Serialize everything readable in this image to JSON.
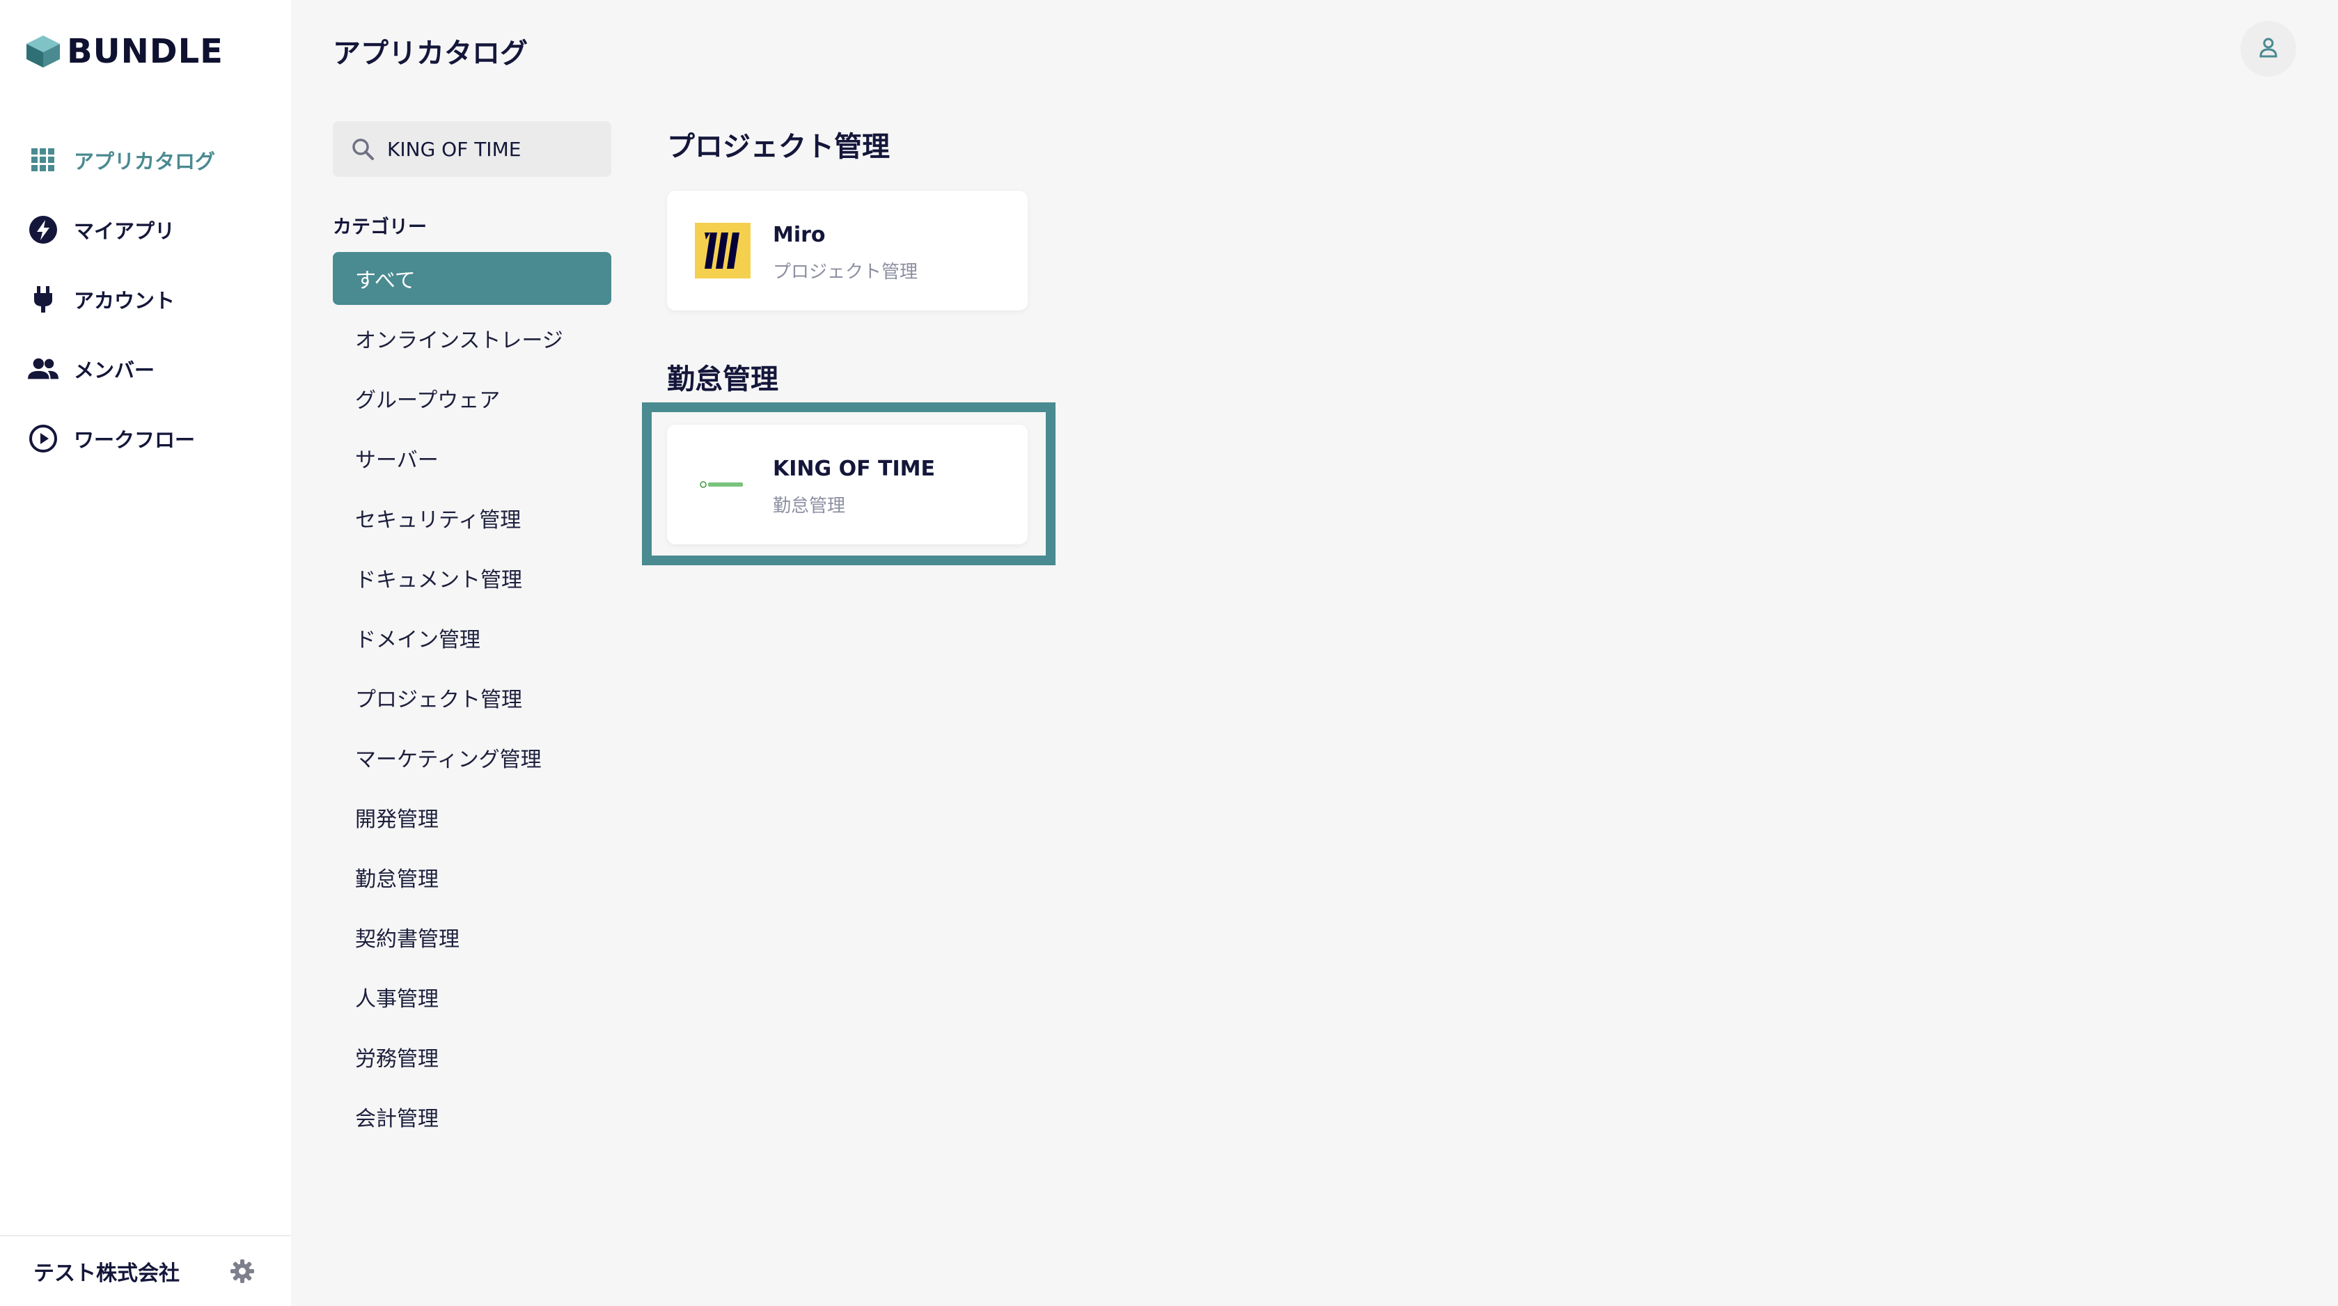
{
  "app": {
    "brand": "BUNDLE",
    "page_title": "アプリカタログ"
  },
  "colors": {
    "accent": "#4a8a91",
    "text": "#14163a",
    "miro_yellow": "#f5d04f"
  },
  "nav": {
    "items": [
      {
        "label": "アプリカタログ",
        "icon": "grid-icon",
        "active": true
      },
      {
        "label": "マイアプリ",
        "icon": "lightning-icon"
      },
      {
        "label": "アカウント",
        "icon": "plug-icon"
      },
      {
        "label": "メンバー",
        "icon": "people-icon"
      },
      {
        "label": "ワークフロー",
        "icon": "play-circle-icon"
      }
    ]
  },
  "footer": {
    "company": "テスト株式会社",
    "settings_icon": "gear-icon"
  },
  "search": {
    "value": "KING OF TIME",
    "icon": "search-icon"
  },
  "categories": {
    "heading": "カテゴリー",
    "items": [
      "すべて",
      "オンラインストレージ",
      "グループウェア",
      "サーバー",
      "セキュリティ管理",
      "ドキュメント管理",
      "ドメイン管理",
      "プロジェクト管理",
      "マーケティング管理",
      "開発管理",
      "勤怠管理",
      "契約書管理",
      "人事管理",
      "労務管理",
      "会計管理"
    ],
    "selected": "すべて"
  },
  "sections": [
    {
      "title": "プロジェクト管理",
      "apps": [
        {
          "name": "Miro",
          "category": "プロジェクト管理"
        }
      ]
    },
    {
      "title": "勤怠管理",
      "apps": [
        {
          "name": "KING OF TIME",
          "category": "勤怠管理"
        }
      ]
    }
  ]
}
